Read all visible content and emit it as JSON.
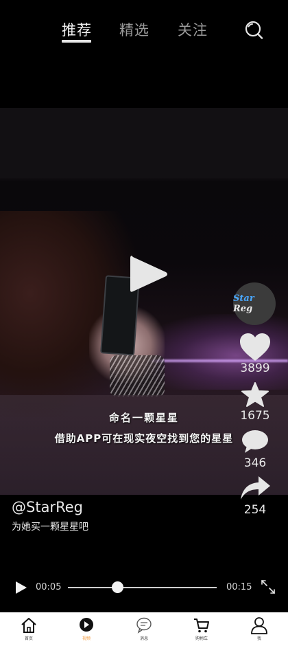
{
  "top_tabs": {
    "items": [
      {
        "label": "推荐",
        "active": true
      },
      {
        "label": "精选",
        "active": false
      },
      {
        "label": "关注",
        "active": false
      }
    ],
    "search_icon": "search-icon"
  },
  "video": {
    "captions": [
      "命名一颗星星",
      "借助APP可在现实夜空找到您的星星"
    ],
    "play_icon": "play-icon"
  },
  "rail": {
    "avatar_text": {
      "star": "Star",
      "reg": "Reg"
    },
    "likes": "3899",
    "favorites": "1675",
    "comments": "346",
    "shares": "254"
  },
  "author": {
    "handle": "@StarReg",
    "description": "为她买一颗星星吧"
  },
  "player": {
    "current_time": "00:05",
    "duration": "00:15",
    "progress": 0.333
  },
  "bottom_nav": {
    "items": [
      {
        "label": "首页",
        "icon": "home-icon"
      },
      {
        "label": "视频",
        "icon": "play-circle-icon",
        "active": true
      },
      {
        "label": "消息",
        "icon": "message-icon"
      },
      {
        "label": "购物车",
        "icon": "cart-icon"
      },
      {
        "label": "我",
        "icon": "user-icon"
      }
    ],
    "active_color": "#f29a3d"
  }
}
